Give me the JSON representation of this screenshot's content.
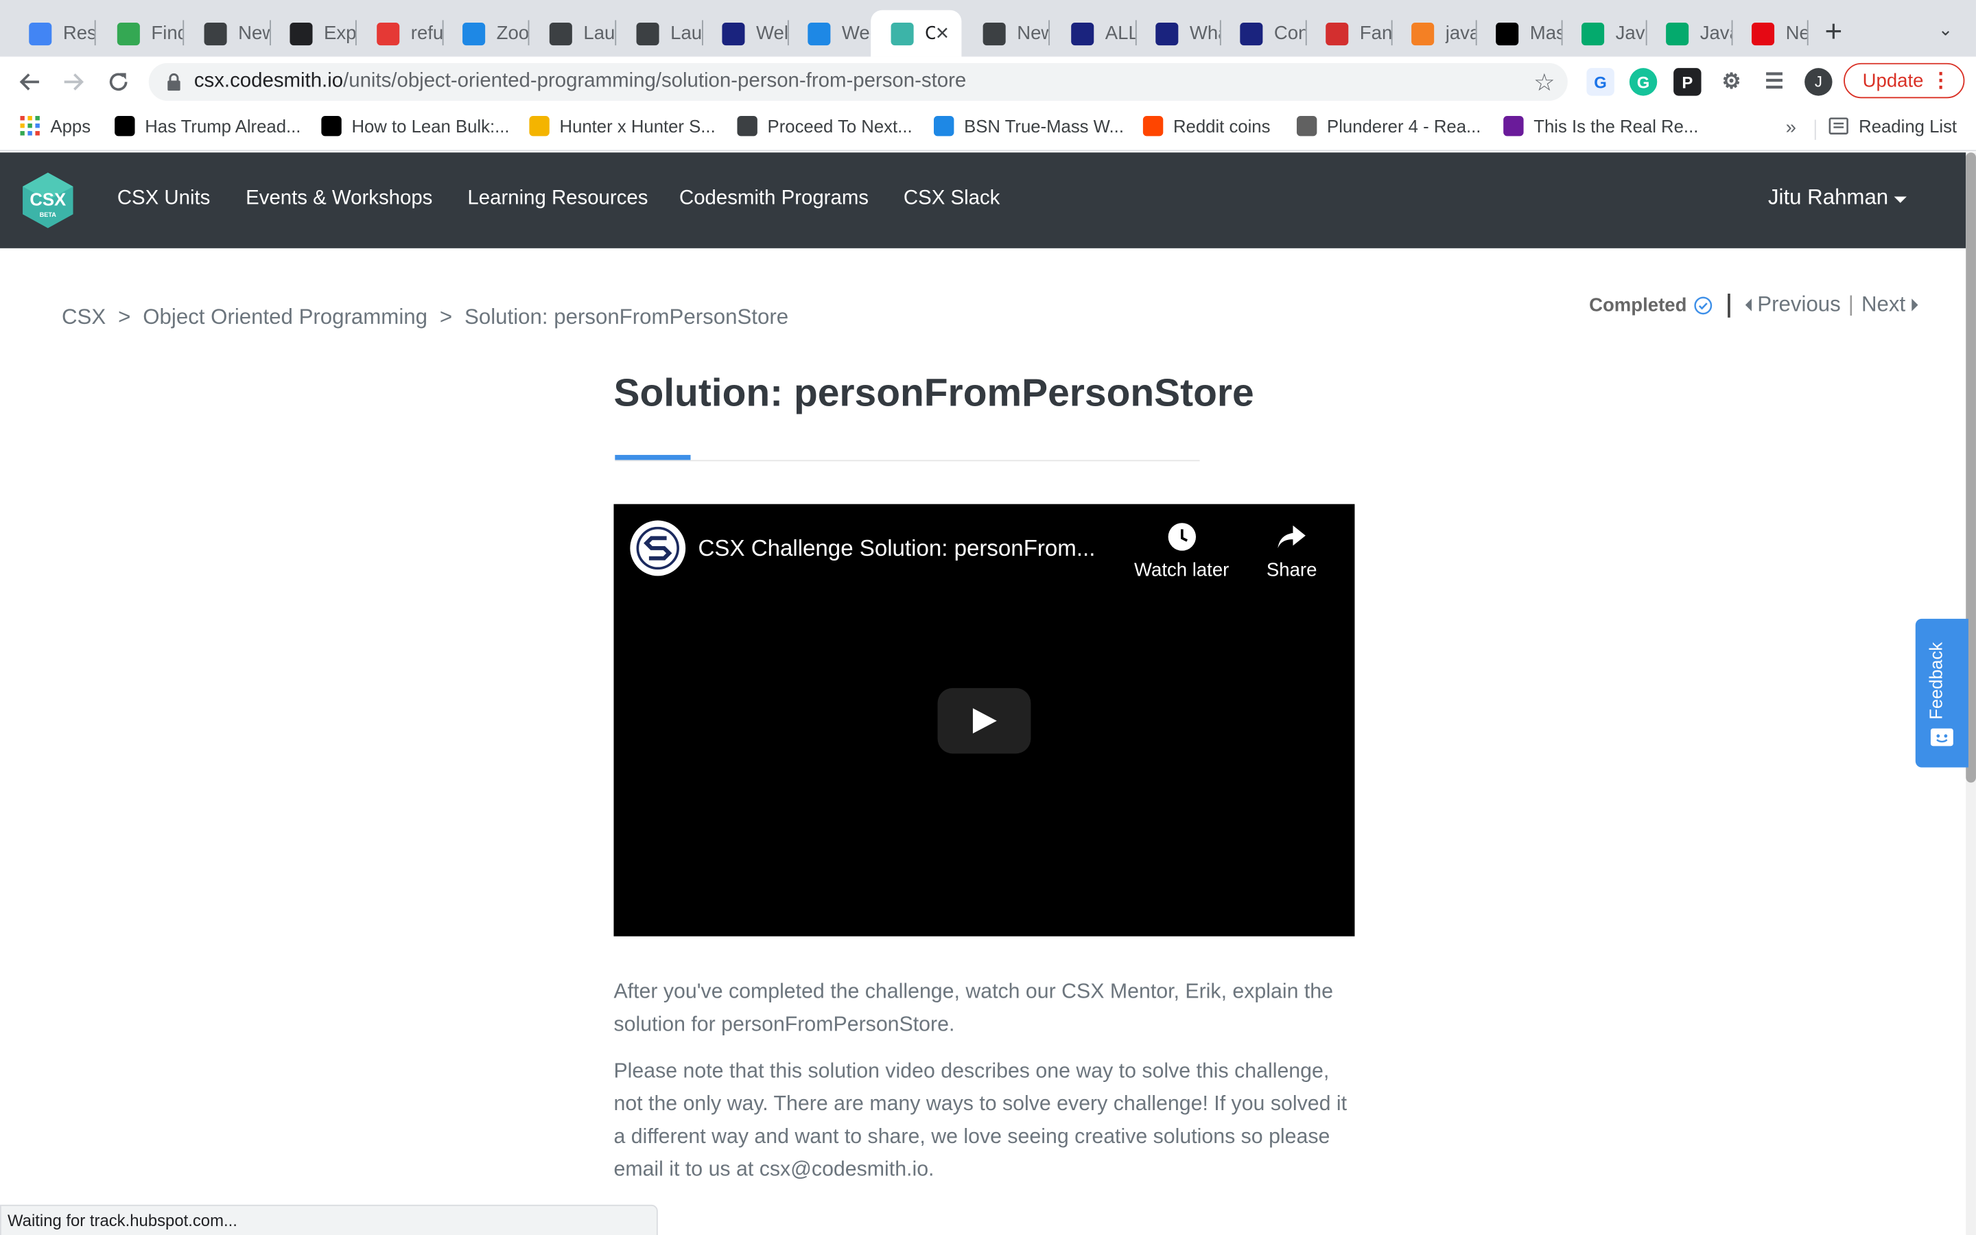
{
  "browser": {
    "tabs": [
      {
        "label": "Resu",
        "icon": "google-docs-icon",
        "color": "#4285f4"
      },
      {
        "label": "Find",
        "icon": "glasses-icon",
        "color": "#34a853"
      },
      {
        "label": "New",
        "icon": "chrome-icon",
        "color": "#3c4043"
      },
      {
        "label": "Expe",
        "icon": "plane-icon",
        "color": "#202124"
      },
      {
        "label": "refu",
        "icon": "tp-icon",
        "color": "#e53935"
      },
      {
        "label": "Zoo",
        "icon": "graduation-cap-icon",
        "color": "#1e88e5"
      },
      {
        "label": "Laur",
        "icon": "globe-icon",
        "color": "#3c4043"
      },
      {
        "label": "Laur",
        "icon": "globe-icon",
        "color": "#3c4043"
      },
      {
        "label": "Wel",
        "icon": "chart-icon",
        "color": "#1a237e"
      },
      {
        "label": "Wee",
        "icon": "graduation-cap-icon",
        "color": "#1e88e5"
      },
      {
        "label": "C",
        "icon": "csx-tab-icon",
        "color": "#3cb4a8",
        "active": true
      },
      {
        "label": "New",
        "icon": "chrome-icon",
        "color": "#3c4043"
      },
      {
        "label": "ALL",
        "icon": "seventeen-icon",
        "color": "#1a237e"
      },
      {
        "label": "Wha",
        "icon": "seventeen-icon",
        "color": "#1a237e"
      },
      {
        "label": "Con",
        "icon": "seventeen-icon",
        "color": "#1a237e"
      },
      {
        "label": "Fan",
        "icon": "checker-icon",
        "color": "#d32f2f"
      },
      {
        "label": "java",
        "icon": "stackoverflow-icon",
        "color": "#f48024"
      },
      {
        "label": "Mas",
        "icon": "dev-icon",
        "color": "#000000"
      },
      {
        "label": "Java",
        "icon": "w3-icon",
        "color": "#04aa6d"
      },
      {
        "label": "Java",
        "icon": "w3-icon",
        "color": "#04aa6d"
      },
      {
        "label": "Net",
        "icon": "netflix-icon",
        "color": "#e50914"
      }
    ],
    "url_host": "csx.codesmith.io",
    "url_path": "/units/object-oriented-programming/solution-person-from-person-store",
    "profile_initial": "J",
    "update_label": "Update",
    "bookmarks": [
      {
        "label": "Apps",
        "icon": "apps-grid-icon",
        "color": "#4285f4"
      },
      {
        "label": "Has Trump Alread...",
        "icon": "h-icon",
        "color": "#000000"
      },
      {
        "label": "How to Lean Bulk:...",
        "icon": "g-icon",
        "color": "#000000"
      },
      {
        "label": "Hunter x Hunter S...",
        "icon": "hexagon-icon",
        "color": "#f4b400"
      },
      {
        "label": "Proceed To Next...",
        "icon": "globe-icon",
        "color": "#3c4043"
      },
      {
        "label": "BSN True-Mass W...",
        "icon": "b-icon",
        "color": "#1e88e5"
      },
      {
        "label": "Reddit coins",
        "icon": "reddit-icon",
        "color": "#ff4500"
      },
      {
        "label": "Plunderer 4 - Rea...",
        "icon": "anime-icon",
        "color": "#616161"
      },
      {
        "label": "This Is the Real Re...",
        "icon": "s-icon",
        "color": "#6a1b9a"
      }
    ],
    "reading_list_label": "Reading List",
    "status_text": "Waiting for track.hubspot.com..."
  },
  "site": {
    "logo_text": "CSX",
    "logo_sub": "BETA",
    "nav": [
      "CSX Units",
      "Events & Workshops",
      "Learning Resources",
      "Codesmith Programs",
      "CSX Slack"
    ],
    "user_name": "Jitu Rahman"
  },
  "page": {
    "breadcrumb": [
      "CSX",
      ">",
      "Object Oriented Programming",
      ">",
      "Solution: personFromPersonStore"
    ],
    "completed_label": "Completed",
    "previous_label": "Previous",
    "next_label": "Next",
    "title": "Solution: personFromPersonStore",
    "video": {
      "title": "CSX Challenge Solution: personFrom...",
      "watch_later_label": "Watch later",
      "share_label": "Share"
    },
    "paragraphs": [
      "After you've completed the challenge, watch our CSX Mentor, Erik, explain the solution for personFromPersonStore.",
      "Please note that this solution video describes one way to solve this challenge, not the only way. There are many ways to solve every challenge! If you solved it a different way and want to share, we love seeing creative solutions so please email it to us at csx@codesmith.io."
    ],
    "feedback_label": "Feedback"
  },
  "colors": {
    "accent": "#3d8fe8",
    "nav_bg": "#343a40",
    "logo_green": "#3cb4a8"
  }
}
